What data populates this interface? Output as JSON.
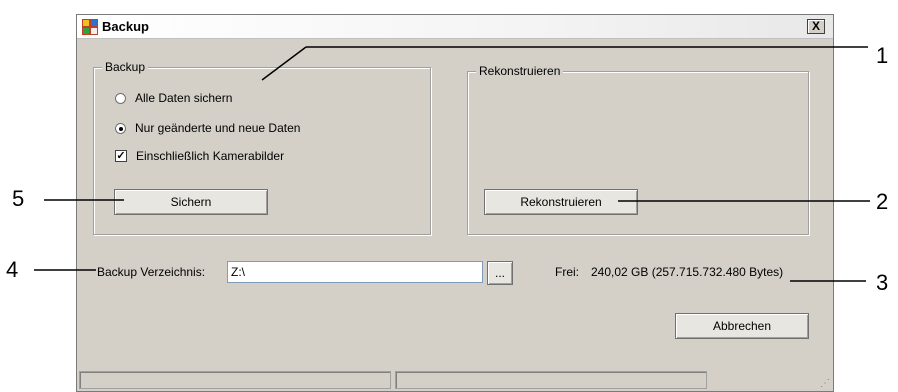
{
  "window": {
    "title": "Backup",
    "close_label": "X"
  },
  "backup_group": {
    "title": "Backup",
    "radio_all": "Alle Daten sichern",
    "radio_changed": "Nur geänderte und neue Daten",
    "checkbox_camera": "Einschließlich Kamerabilder",
    "checkbox_checked_mark": "✓",
    "button_label": "Sichern"
  },
  "restore_group": {
    "title": "Rekonstruieren",
    "button_label": "Rekonstruieren"
  },
  "directory": {
    "label": "Backup Verzeichnis:",
    "value": "Z:\\",
    "browse_label": "...",
    "free_label": "Frei:",
    "free_value": "240,02 GB (257.715.732.480 Bytes)"
  },
  "cancel_label": "Abbrechen",
  "callouts": {
    "one": "1",
    "two": "2",
    "three": "3",
    "four": "4",
    "five": "5"
  }
}
